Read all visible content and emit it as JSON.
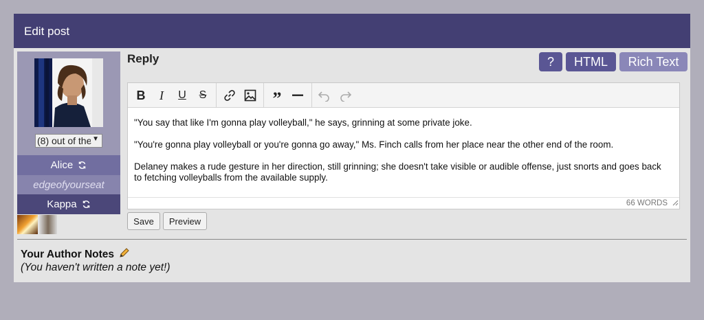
{
  "header": {
    "title": "Edit post"
  },
  "sidebar": {
    "avatar_icon": "user-avatar",
    "avatar_select_value": "(8) out of the",
    "character": "Alice",
    "journal": "edgeofyourseat",
    "account": "Kappa"
  },
  "compose": {
    "label": "Reply",
    "modes": {
      "help": "?",
      "html": "HTML",
      "rich_text": "Rich Text"
    },
    "toolbar_icons": [
      "bold-icon",
      "italic-icon",
      "underline-icon",
      "strikethrough-icon",
      "link-icon",
      "image-icon",
      "blockquote-icon",
      "horizontal-rule-icon",
      "undo-icon",
      "redo-icon"
    ],
    "paragraphs": [
      "\"You say that like I'm gonna play volleyball,\" he says, grinning at some private joke.",
      "\"You're gonna play volleyball or you're gonna go away,\" Ms. Finch calls from her place near the other end of the room.",
      "Delaney makes a rude gesture in her direction, still grinning; she doesn't take visible or audible offense, just snorts and goes back to fetching volleyballs from the available supply."
    ],
    "word_count": "66 WORDS",
    "save_label": "Save",
    "preview_label": "Preview"
  },
  "author_notes": {
    "title": "Your Author Notes",
    "text": "(You haven't written a note yet!)"
  },
  "colors": {
    "header_bg": "#433f73",
    "panel_bg": "#e4e4e4",
    "page_bg": "#b0aeba",
    "button_primary": "#5a5694",
    "button_inactive": "#8a87b8"
  }
}
